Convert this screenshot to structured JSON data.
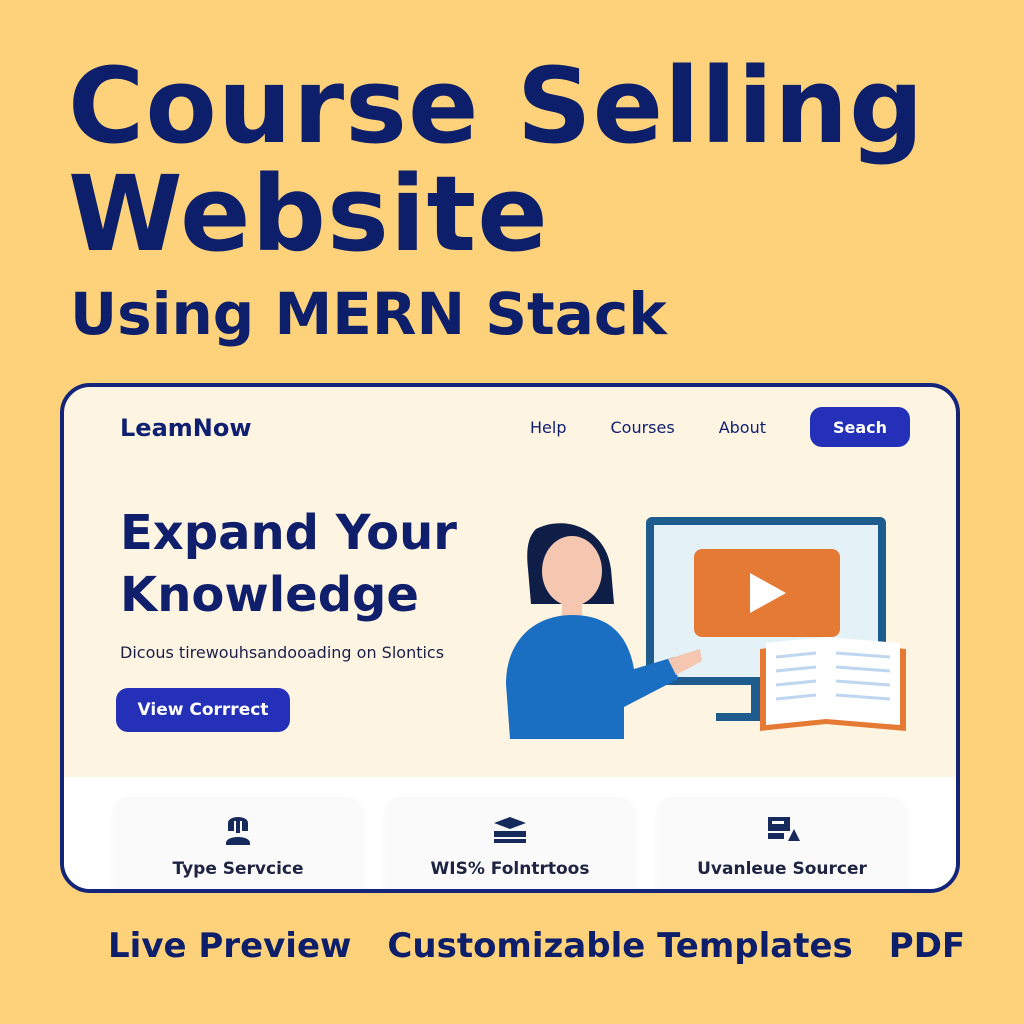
{
  "banner": {
    "title_line1": "Course Selling",
    "title_line2": "Website",
    "subtitle": "Using MERN Stack"
  },
  "site": {
    "logo": "LeamNow",
    "nav": [
      "Help",
      "Courses",
      "About"
    ],
    "search_label": "Seach"
  },
  "hero": {
    "title_line1": "Expand Your",
    "title_line2": "Knowledge",
    "description": "Dicous tirewouhsandooading on Slontics",
    "cta_label": "View Corrrect"
  },
  "features": [
    {
      "label": "Type Servcice",
      "icon": "person-icon"
    },
    {
      "label": "WIS% Folntrtoos",
      "icon": "graduation-cap-icon"
    },
    {
      "label": "Uvanleue Sourcer",
      "icon": "document-shapes-icon"
    }
  ],
  "footer": {
    "items": [
      "Live Preview",
      "Customizable Templates",
      "PDF"
    ]
  },
  "colors": {
    "background": "#FDD27A",
    "navy": "#0D1F6A",
    "button": "#2430B8",
    "play": "#E57A34",
    "shirt": "#1B6FC2"
  }
}
